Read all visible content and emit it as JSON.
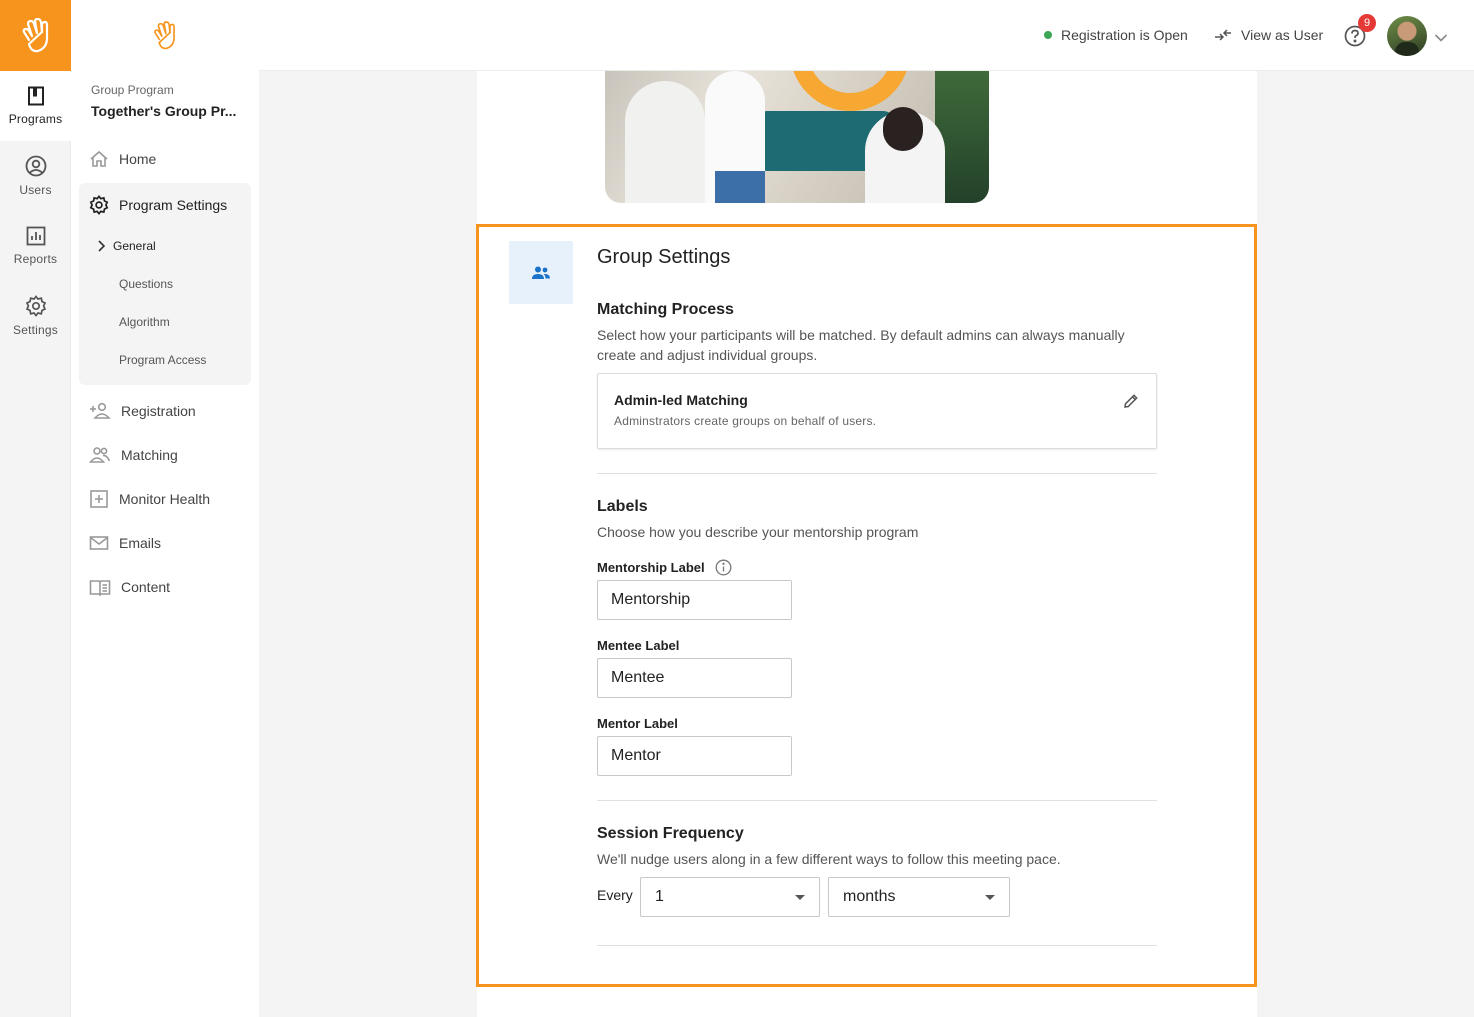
{
  "rail": {
    "items": [
      {
        "label": "Programs",
        "icon": "book-icon",
        "active": true
      },
      {
        "label": "Users",
        "icon": "user-circle-icon"
      },
      {
        "label": "Reports",
        "icon": "bar-chart-icon"
      },
      {
        "label": "Settings",
        "icon": "gear-icon"
      }
    ]
  },
  "sidebar": {
    "program_caption": "Group Program",
    "program_name": "Together's Group Pr...",
    "items": [
      {
        "label": "Home",
        "icon": "home-icon"
      },
      {
        "label": "Program Settings",
        "icon": "gear-icon",
        "expanded": true
      },
      {
        "label": "Registration",
        "icon": "add-user-icon"
      },
      {
        "label": "Matching",
        "icon": "people-icon"
      },
      {
        "label": "Monitor Health",
        "icon": "plus-square-icon"
      },
      {
        "label": "Emails",
        "icon": "mail-icon"
      },
      {
        "label": "Content",
        "icon": "open-book-icon"
      }
    ],
    "subitems": [
      {
        "label": "General",
        "active": true
      },
      {
        "label": "Questions"
      },
      {
        "label": "Algorithm"
      },
      {
        "label": "Program Access"
      }
    ]
  },
  "topbar": {
    "status": "Registration is Open",
    "view_as": "View as User",
    "notifications": "9"
  },
  "group_settings": {
    "title": "Group Settings",
    "matching": {
      "heading": "Matching Process",
      "description": "Select how your participants will be matched. By default admins can always manually create and adjust individual groups.",
      "card_title": "Admin-led Matching",
      "card_subtitle": "Adminstrators create groups on behalf of users."
    },
    "labels": {
      "heading": "Labels",
      "description": "Choose how you describe your mentorship program",
      "mentorship_label": "Mentorship Label",
      "mentorship_value": "Mentorship",
      "mentee_label": "Mentee Label",
      "mentee_value": "Mentee",
      "mentor_label": "Mentor Label",
      "mentor_value": "Mentor"
    },
    "session": {
      "heading": "Session Frequency",
      "description": "We'll nudge users along in a few different ways to follow this meeting pace.",
      "every_label": "Every",
      "count_value": "1",
      "unit_value": "months"
    }
  },
  "colors": {
    "brand_orange": "#f7941d",
    "status_green": "#3aa757",
    "badge_red": "#e53935",
    "icon_blue": "#1a73c9"
  }
}
